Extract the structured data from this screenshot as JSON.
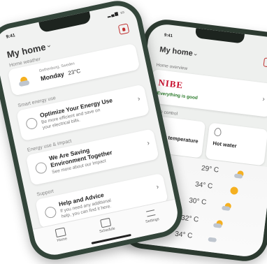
{
  "back_phone": {
    "time": "9:41",
    "title": "My home",
    "sections": {
      "overview": "Home overview",
      "control": "Home control"
    },
    "brand": "NIBE",
    "status": "Everything is good",
    "controls": [
      {
        "label": "Indoor temperature"
      },
      {
        "label": "Hot water"
      }
    ],
    "forecast": [
      {
        "temp": "29° C",
        "icon": "sun-cloud-icon"
      },
      {
        "temp": "34° C",
        "icon": "sun-icon"
      },
      {
        "temp": "30° C",
        "icon": "sun-cloud-icon"
      },
      {
        "temp": "32° C",
        "icon": "sun-cloud-icon"
      },
      {
        "temp": "34° C",
        "icon": "sun-cloud-icon"
      }
    ]
  },
  "front_phone": {
    "time": "9:41",
    "title": "My home",
    "sections": {
      "weather": "Home weather",
      "energy_use": "Smart energy use",
      "energy_impact": "Energy use & impact",
      "support": "Support"
    },
    "weather_card": {
      "location": "Gothenburg, Sweden",
      "day": "Monday",
      "temp": "23°C"
    },
    "optimize_card": {
      "title": "Optimize Your Energy Use",
      "sub1": "Be more efficient and save on",
      "sub2": "your electrical bills."
    },
    "saving_card": {
      "title1": "We Are Saving",
      "title2": "Environment Together",
      "sub": "See more about our Impact"
    },
    "help_card": {
      "title": "Help and Advice",
      "sub1": "If you need any additional",
      "sub2": "help, you can find it here."
    },
    "tabs": [
      {
        "label": "Home",
        "icon": "home-icon"
      },
      {
        "label": "Schedule",
        "icon": "calendar-icon"
      },
      {
        "label": "Settings",
        "icon": "sliders-icon"
      }
    ]
  }
}
